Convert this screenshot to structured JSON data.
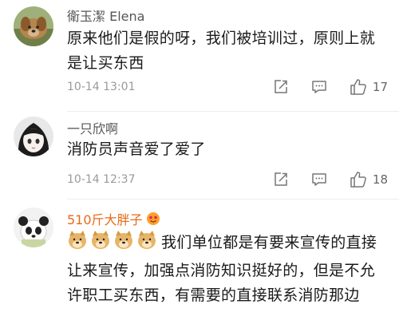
{
  "comments": [
    {
      "user": "衛玉潔 Elena",
      "text": "原来他们是假的呀，我们被培训过，原则上就是让买东西",
      "time": "10-14 13:01",
      "likes": "17",
      "avatar_icon": "dog-avatar"
    },
    {
      "user": "一只欣啊",
      "text": "消防员声音爱了爱了",
      "time": "10-14 12:37",
      "likes": "18",
      "avatar_icon": "anime-girl-avatar"
    },
    {
      "user": "510斤大胖子",
      "text": "我们单位都是有要来宣传的直接让来宣传，加强点消防知识挺好的，但是不允许职工买东西，有需要的直接联系消防那边",
      "emoji_count": 4,
      "emoji_icon": "doge-emoji",
      "badge_icon": "vip-heart-badge",
      "avatar_icon": "panda-avatar"
    }
  ],
  "icons": {
    "share": "share-icon",
    "reply": "reply-icon",
    "like": "thumbs-up-icon"
  },
  "colors": {
    "vip_name": "#e86a17",
    "time": "#9a9a9a"
  }
}
